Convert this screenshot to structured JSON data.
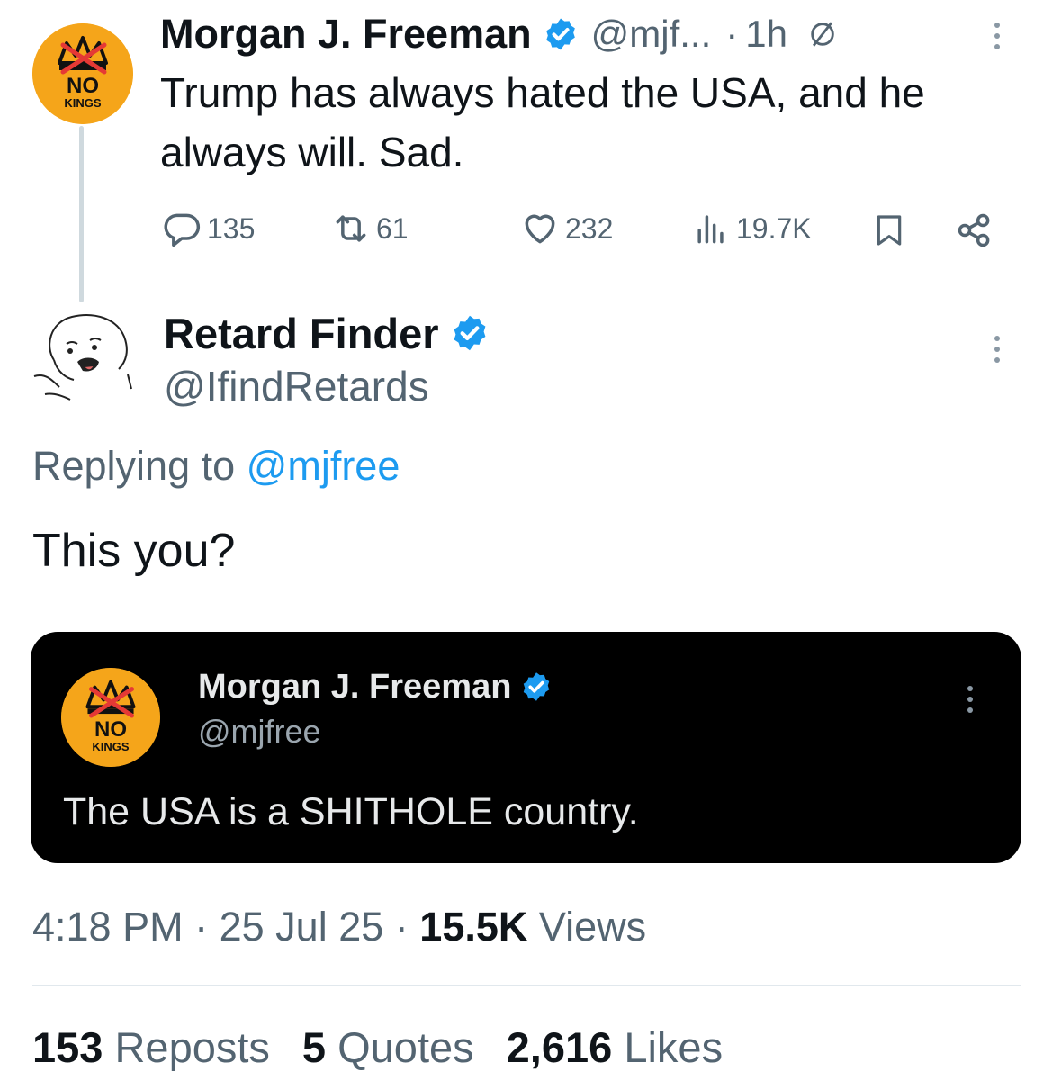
{
  "parent_tweet": {
    "display_name": "Morgan J. Freeman",
    "handle": "@mjf...",
    "separator": "·",
    "time_ago": "1h",
    "text": "Trump has always hated the USA, and he always will. Sad.",
    "avatar_text_top": "NO",
    "avatar_text_bottom": "KINGS",
    "actions": {
      "replies": "135",
      "reposts": "61",
      "likes": "232",
      "views": "19.7K"
    }
  },
  "reply_tweet": {
    "display_name": "Retard Finder",
    "handle": "@IfindRetards",
    "replying_prefix": "Replying to",
    "replying_handle": "@mjfree",
    "text": "This you?"
  },
  "quoted_tweet": {
    "display_name": "Morgan J. Freeman",
    "handle": "@mjfree",
    "text": "The USA is a SHITHOLE country.",
    "avatar_text_top": "NO",
    "avatar_text_bottom": "KINGS"
  },
  "meta": {
    "time": "4:18 PM",
    "date": "25 Jul 25",
    "separator": "·",
    "views_count": "15.5K",
    "views_label": "Views"
  },
  "stats": {
    "reposts_count": "153",
    "reposts_label": "Reposts",
    "quotes_count": "5",
    "quotes_label": "Quotes",
    "likes_count": "2,616",
    "likes_label": "Likes"
  },
  "colors": {
    "accent": "#1d9bf0",
    "verified": "#1d9bf0",
    "muted": "#536471",
    "avatar_orange": "#f5a51a",
    "crown_red": "#e53935"
  },
  "icons": [
    "verified-badge-icon",
    "muted-icon",
    "more-icon",
    "reply-icon",
    "repost-icon",
    "like-icon",
    "views-icon",
    "bookmark-icon",
    "share-icon"
  ]
}
